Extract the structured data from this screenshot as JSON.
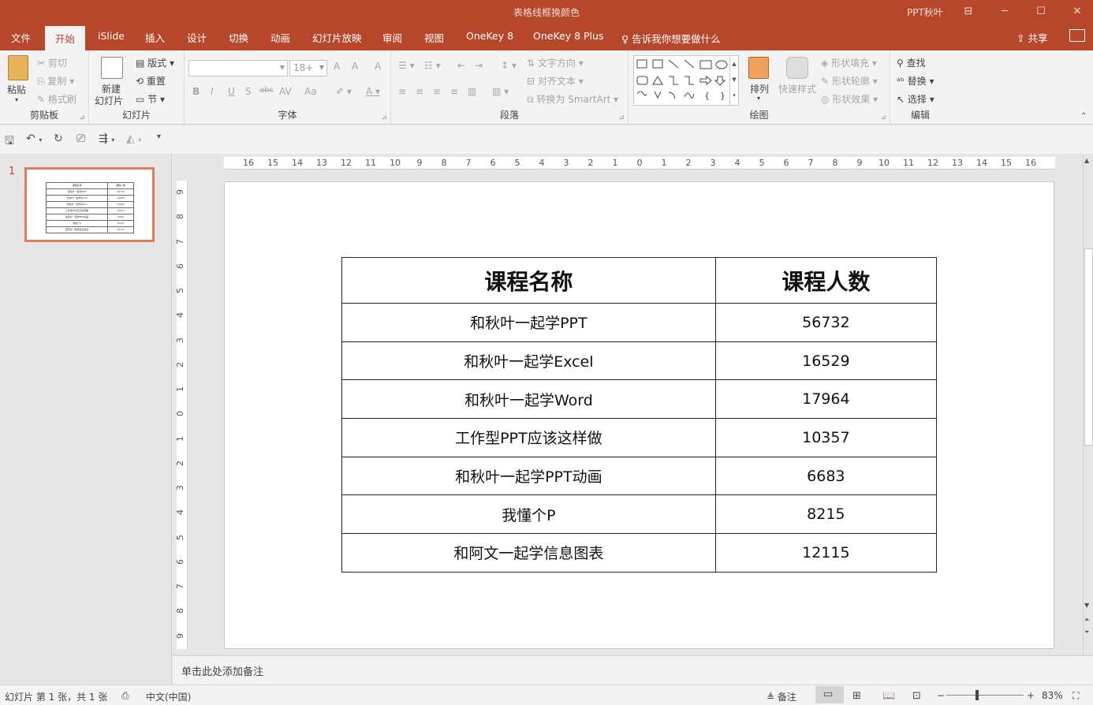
{
  "titlebar": {
    "title": "表格线框换颜色",
    "user": "PPT秋叶",
    "ribbon_display_icon": "⊟",
    "minimize_icon": "─",
    "maximize_icon": "☐",
    "close_icon": "✕"
  },
  "menu": {
    "tabs": [
      "文件",
      "开始",
      "iSlide",
      "插入",
      "设计",
      "切换",
      "动画",
      "幻灯片放映",
      "审阅",
      "视图",
      "OneKey 8",
      "OneKey 8 Plus"
    ],
    "active_tab": "开始",
    "tellme": "告诉我你想要做什么",
    "share": "共享"
  },
  "ribbon": {
    "clipboard": {
      "label": "剪贴板",
      "paste": "粘贴",
      "cut": "剪切",
      "copy": "复制",
      "format_painter": "格式刷"
    },
    "slides": {
      "label": "幻灯片",
      "new_slide_line1": "新建",
      "new_slide_line2": "幻灯片",
      "layout": "版式",
      "reset": "重置",
      "section": "节"
    },
    "font": {
      "label": "字体",
      "font_name": "",
      "font_size": "18+",
      "bold": "B",
      "italic": "I",
      "underline": "U",
      "shadow": "S",
      "strike": "abc",
      "spacing": "AV",
      "case": "Aa",
      "grow": "A",
      "shrink": "A",
      "clear": "A"
    },
    "paragraph": {
      "label": "段落",
      "text_direction": "文字方向",
      "align_text": "对齐文本",
      "smartart": "转换为 SmartArt"
    },
    "drawing": {
      "label": "绘图",
      "arrange": "排列",
      "quick_styles": "快速样式",
      "shape_fill": "形状填充",
      "shape_outline": "形状轮廓",
      "shape_effects": "形状效果"
    },
    "editing": {
      "label": "编辑",
      "find": "查找",
      "replace": "替换",
      "select": "选择"
    }
  },
  "slide_panel": {
    "slide_number": "1"
  },
  "ruler": {
    "horizontal": [
      "16",
      "15",
      "14",
      "13",
      "12",
      "11",
      "10",
      "9",
      "8",
      "7",
      "6",
      "5",
      "4",
      "3",
      "2",
      "1",
      "0",
      "1",
      "2",
      "3",
      "4",
      "5",
      "6",
      "7",
      "8",
      "9",
      "10",
      "11",
      "12",
      "13",
      "14",
      "15",
      "16"
    ],
    "vertical": [
      "9",
      "8",
      "7",
      "6",
      "5",
      "4",
      "3",
      "2",
      "1",
      "0",
      "1",
      "2",
      "3",
      "4",
      "5",
      "6",
      "7",
      "8",
      "9"
    ]
  },
  "table": {
    "headers": [
      "课程名称",
      "课程人数"
    ],
    "rows": [
      [
        "和秋叶一起学PPT",
        "56732"
      ],
      [
        "和秋叶一起学Excel",
        "16529"
      ],
      [
        "和秋叶一起学Word",
        "17964"
      ],
      [
        "工作型PPT应该这样做",
        "10357"
      ],
      [
        "和秋叶一起学PPT动画",
        "6683"
      ],
      [
        "我懂个P",
        "8215"
      ],
      [
        "和阿文一起学信息图表",
        "12115"
      ]
    ]
  },
  "notes": {
    "placeholder": "单击此处添加备注"
  },
  "status": {
    "slide_info": "幻灯片 第 1 张，共 1 张",
    "language": "中文(中国)",
    "notes_btn": "备注",
    "zoom": "83%"
  },
  "colors": {
    "accent": "#b7472a",
    "thumb_border": "#e47c5b"
  }
}
